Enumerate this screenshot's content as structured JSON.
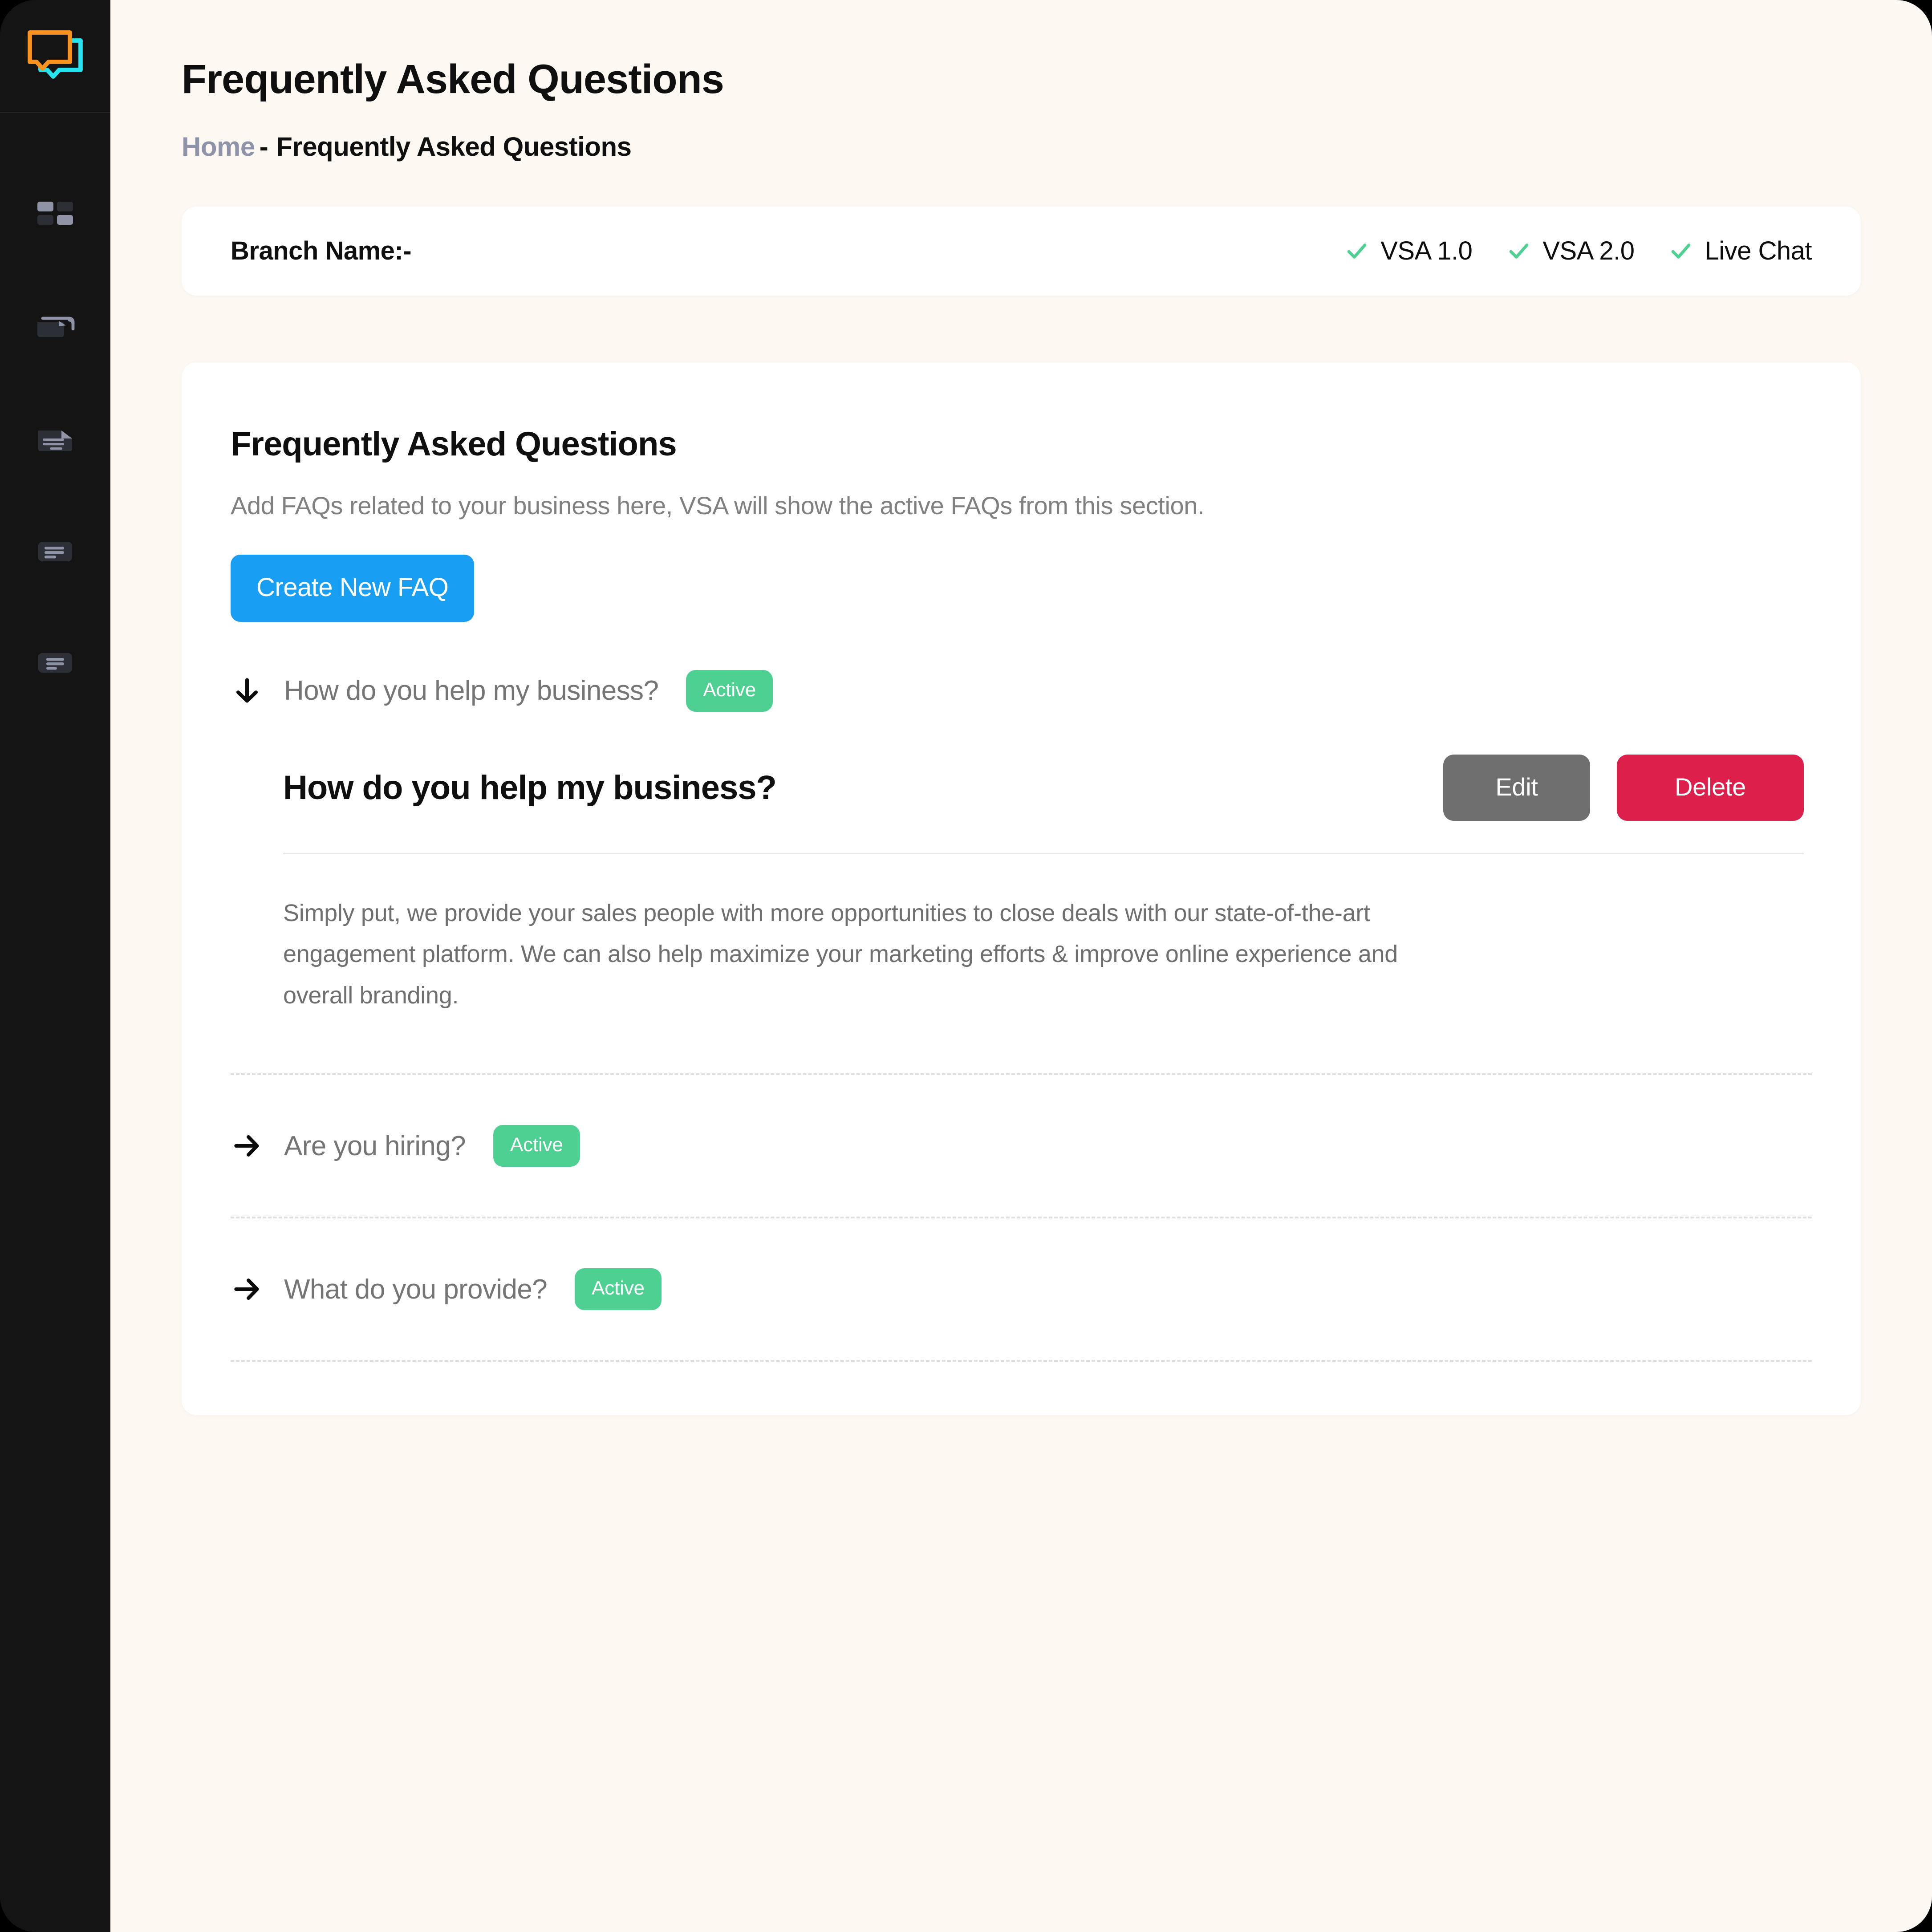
{
  "theme": {
    "page_bg": "#fdf8f1",
    "sidebar_bg": "#141414",
    "card_bg": "#ffffff",
    "accent_blue": "#189ef3",
    "accent_green": "#4ed093",
    "accent_red": "#dd1f4c",
    "accent_grey": "#6f6f6f",
    "logo_orange": "#f7931e",
    "logo_cyan": "#25e4ee"
  },
  "sidebar": {
    "logo_name": "chat-bubbles-logo",
    "items": [
      {
        "icon": "dashboard-grid-icon",
        "name": "sidebar-item-dashboard"
      },
      {
        "icon": "folder-icon",
        "name": "sidebar-item-folder"
      },
      {
        "icon": "document-lines-icon",
        "name": "sidebar-item-documents"
      },
      {
        "icon": "article-list-icon",
        "name": "sidebar-item-articles"
      },
      {
        "icon": "article-list-icon",
        "name": "sidebar-item-pages"
      }
    ]
  },
  "header": {
    "title": "Frequently Asked Questions",
    "breadcrumb": {
      "home": "Home",
      "separator": "-",
      "current": "Frequently Asked Questions"
    }
  },
  "branch_card": {
    "label": "Branch Name:-",
    "channels": [
      {
        "icon": "check-icon",
        "label": "VSA 1.0"
      },
      {
        "icon": "check-icon",
        "label": "VSA 2.0"
      },
      {
        "icon": "check-icon",
        "label": "Live Chat"
      }
    ]
  },
  "faq_section": {
    "title": "Frequently Asked Questions",
    "description": "Add FAQs related to your business here, VSA will show the active FAQs from this section.",
    "create_button": "Create New FAQ",
    "items": [
      {
        "question": "How do you help my business?",
        "status": "Active",
        "expanded": true,
        "arrow_icon": "arrow-down-icon",
        "panel": {
          "title": "How do you help my business?",
          "edit_label": "Edit",
          "delete_label": "Delete",
          "answer": "Simply put, we provide your sales people with more opportunities to close deals with our state-of-the-art engagement platform. We can also help maximize your marketing efforts & improve online experience and overall branding."
        }
      },
      {
        "question": "Are you hiring?",
        "status": "Active",
        "expanded": false,
        "arrow_icon": "arrow-right-icon"
      },
      {
        "question": "What do you provide?",
        "status": "Active",
        "expanded": false,
        "arrow_icon": "arrow-right-icon"
      }
    ]
  }
}
